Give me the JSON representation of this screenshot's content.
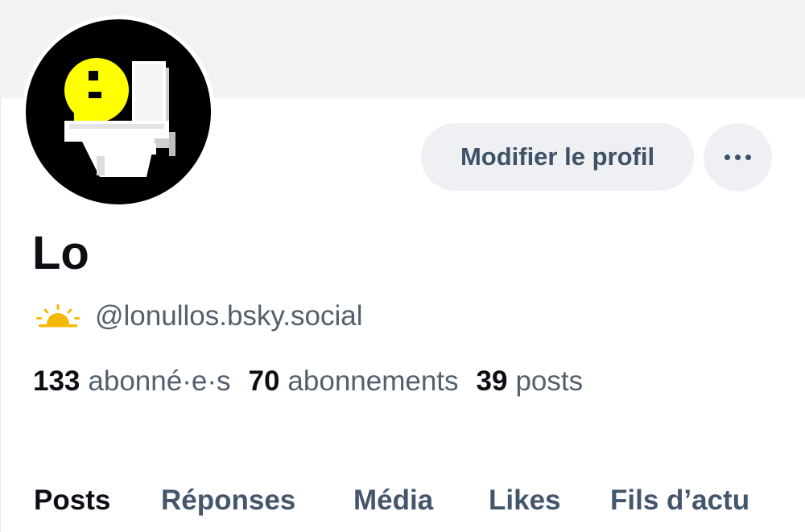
{
  "profile": {
    "display_name": "Lo",
    "handle": "@lonullos.bsky.social",
    "status_icon": "sunrise-icon",
    "avatar_icon": "yellow-face-toilet-avatar"
  },
  "actions": {
    "edit_profile_label": "Modifier le profil",
    "more_icon": "ellipsis-icon"
  },
  "stats": {
    "followers_count": "133",
    "followers_label": "abonné·e·s",
    "following_count": "70",
    "following_label": "abonnements",
    "posts_count": "39",
    "posts_label": "posts"
  },
  "tabs": [
    {
      "label": "Posts",
      "active": true
    },
    {
      "label": "Réponses",
      "active": false
    },
    {
      "label": "Média",
      "active": false
    },
    {
      "label": "Likes",
      "active": false
    },
    {
      "label": "Fils d’actu",
      "active": false
    }
  ],
  "colors": {
    "banner": "#f1f2f4",
    "button_bg": "#eef0f3",
    "primary_text": "#0b0f14",
    "secondary_text": "#52606d",
    "tab_inactive": "#44566b",
    "sun_yellow": "#f5b800"
  }
}
